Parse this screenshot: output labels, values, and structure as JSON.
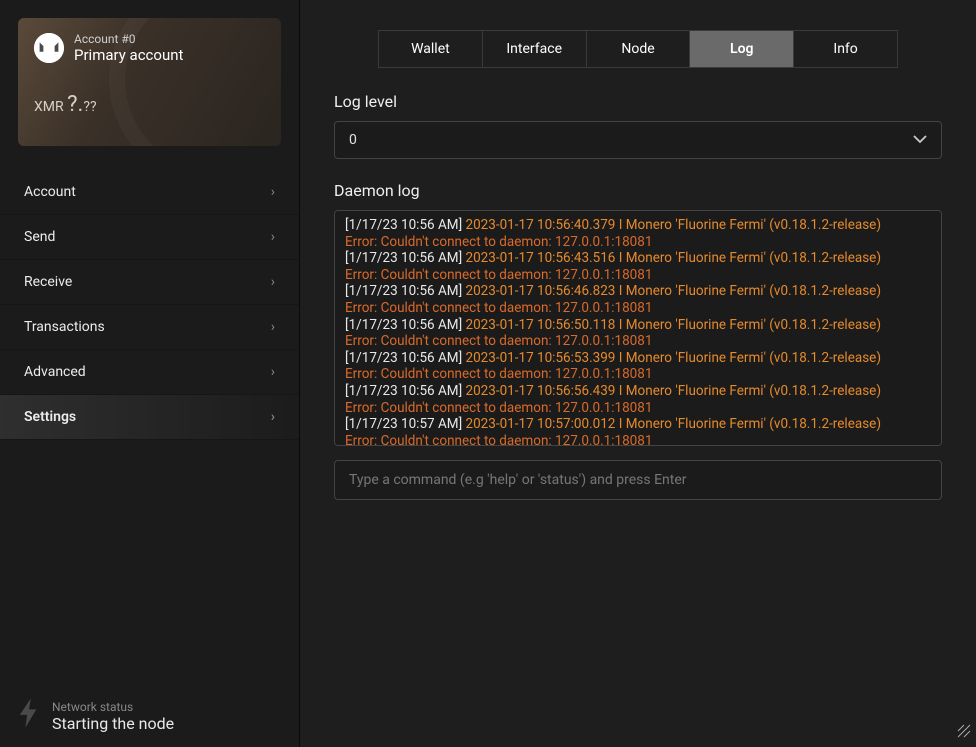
{
  "account": {
    "number_label": "Account #0",
    "name": "Primary account",
    "currency": "XMR",
    "balance_major": "?.",
    "balance_minor": "??"
  },
  "nav": {
    "items": [
      {
        "label": "Account",
        "active": false
      },
      {
        "label": "Send",
        "active": false
      },
      {
        "label": "Receive",
        "active": false
      },
      {
        "label": "Transactions",
        "active": false
      },
      {
        "label": "Advanced",
        "active": false
      },
      {
        "label": "Settings",
        "active": true
      }
    ]
  },
  "network": {
    "label": "Network status",
    "text": "Starting the node"
  },
  "tabs": {
    "items": [
      {
        "label": "Wallet",
        "active": false
      },
      {
        "label": "Interface",
        "active": false
      },
      {
        "label": "Node",
        "active": false
      },
      {
        "label": "Log",
        "active": true
      },
      {
        "label": "Info",
        "active": false
      }
    ]
  },
  "log_level": {
    "label": "Log level",
    "value": "0"
  },
  "daemon_log": {
    "label": "Daemon log",
    "entries": [
      {
        "ts": "[1/17/23 10:56 AM]",
        "info": "2023-01-17 10:56:40.379 I Monero 'Fluorine Fermi' (v0.18.1.2-release)",
        "err": "Error: Couldn't connect to daemon: 127.0.0.1:18081"
      },
      {
        "ts": "[1/17/23 10:56 AM]",
        "info": "2023-01-17 10:56:43.516 I Monero 'Fluorine Fermi' (v0.18.1.2-release)",
        "err": "Error: Couldn't connect to daemon: 127.0.0.1:18081"
      },
      {
        "ts": "[1/17/23 10:56 AM]",
        "info": "2023-01-17 10:56:46.823 I Monero 'Fluorine Fermi' (v0.18.1.2-release)",
        "err": "Error: Couldn't connect to daemon: 127.0.0.1:18081"
      },
      {
        "ts": "[1/17/23 10:56 AM]",
        "info": "2023-01-17 10:56:50.118 I Monero 'Fluorine Fermi' (v0.18.1.2-release)",
        "err": "Error: Couldn't connect to daemon: 127.0.0.1:18081"
      },
      {
        "ts": "[1/17/23 10:56 AM]",
        "info": "2023-01-17 10:56:53.399 I Monero 'Fluorine Fermi' (v0.18.1.2-release)",
        "err": "Error: Couldn't connect to daemon: 127.0.0.1:18081"
      },
      {
        "ts": "[1/17/23 10:56 AM]",
        "info": "2023-01-17 10:56:56.439 I Monero 'Fluorine Fermi' (v0.18.1.2-release)",
        "err": "Error: Couldn't connect to daemon: 127.0.0.1:18081"
      },
      {
        "ts": "[1/17/23 10:57 AM]",
        "info": "2023-01-17 10:57:00.012 I Monero 'Fluorine Fermi' (v0.18.1.2-release)",
        "err": "Error: Couldn't connect to daemon: 127.0.0.1:18081"
      }
    ]
  },
  "command_input": {
    "placeholder": "Type a command (e.g 'help' or 'status') and press Enter"
  }
}
